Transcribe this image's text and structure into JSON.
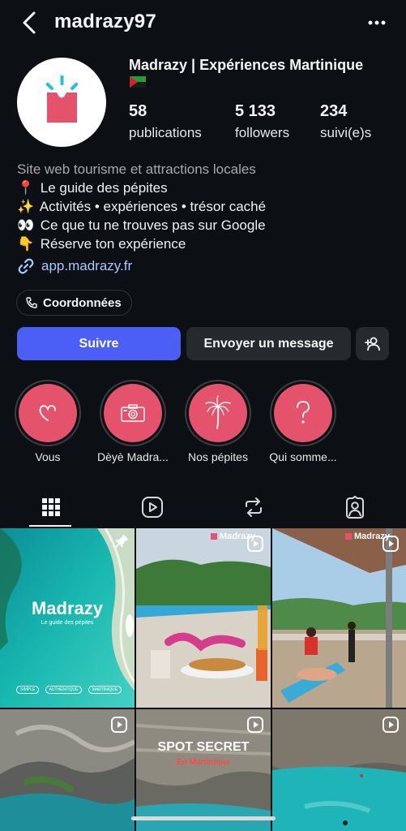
{
  "header": {
    "username": "madrazy97",
    "back_icon": "chevron-left-icon",
    "menu_icon": "more-horizontal-icon"
  },
  "profile": {
    "full_name": "Madrazy | Expériences Martinique",
    "flag_icon": "martinique-flag-icon",
    "avatar_icon": "madrazy-logo-icon",
    "stats": [
      {
        "value": "58",
        "label": "publications"
      },
      {
        "value": "5 133",
        "label": "followers"
      },
      {
        "value": "234",
        "label": "suivi(e)s"
      }
    ]
  },
  "bio": {
    "category": "Site web tourisme et attractions locales",
    "lines": [
      {
        "emoji": "📍",
        "text": "Le guide des pépites"
      },
      {
        "emoji": "✨",
        "text": "Activités • expériences • trésor caché"
      },
      {
        "emoji": "👀",
        "text": "Ce que tu ne trouves pas sur Google"
      },
      {
        "emoji": "👇",
        "text": "Réserve ton expérience"
      }
    ],
    "link": "app.madrazy.fr"
  },
  "actions": {
    "contact": "Coordonnées",
    "follow": "Suivre",
    "message": "Envoyer un message"
  },
  "highlights": [
    {
      "label": "Vous",
      "icon": "heart-icon"
    },
    {
      "label": "Dèyè Madra...",
      "icon": "camera-icon"
    },
    {
      "label": "Nos pépites",
      "icon": "palm-tree-icon"
    },
    {
      "label": "Qui somme...",
      "icon": "question-icon"
    }
  ],
  "tabs": [
    {
      "name": "posts-grid",
      "icon": "grid-icon",
      "active": true
    },
    {
      "name": "reels",
      "icon": "reels-icon",
      "active": false
    },
    {
      "name": "reposts",
      "icon": "repost-icon",
      "active": false
    },
    {
      "name": "tagged",
      "icon": "tagged-user-icon",
      "active": false
    }
  ],
  "posts": {
    "p1": {
      "title": "Madrazy",
      "subtitle": "Le guide des pépites",
      "tags": [
        "SIMPLE",
        "AUTHENTIQUE",
        "MARTINIQUE"
      ],
      "badge": "pin-icon"
    },
    "p2": {
      "brand": "Madrazy",
      "badge": "reel-icon"
    },
    "p3": {
      "brand": "Madrazy",
      "badge": "reel-icon"
    },
    "p4": {
      "badge": "reel-icon"
    },
    "p5": {
      "title": "SPOT SECRET",
      "subtitle": "En Martinique",
      "badge": "reel-icon"
    },
    "p6": {
      "badge": "reel-icon"
    }
  },
  "colors": {
    "background": "#0c1014",
    "accent_blue": "#4b5ef5",
    "brand_pink": "#e5526b",
    "link": "#a9c7ff"
  }
}
